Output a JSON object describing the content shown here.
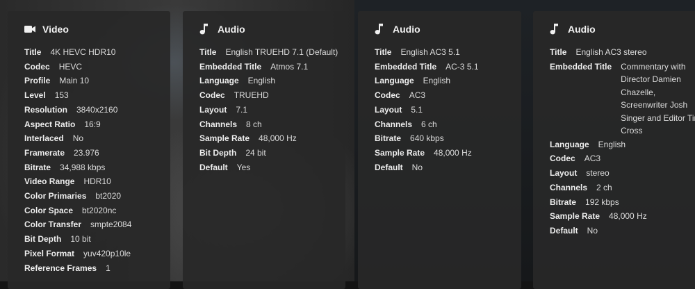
{
  "streams": [
    {
      "title": "Video",
      "icon": "video-camera-icon",
      "rows": [
        {
          "label": "Title",
          "value": "4K HEVC HDR10"
        },
        {
          "label": "Codec",
          "value": "HEVC"
        },
        {
          "label": "Profile",
          "value": "Main 10"
        },
        {
          "label": "Level",
          "value": "153"
        },
        {
          "label": "Resolution",
          "value": "3840x2160"
        },
        {
          "label": "Aspect Ratio",
          "value": "16:9"
        },
        {
          "label": "Interlaced",
          "value": "No"
        },
        {
          "label": "Framerate",
          "value": "23.976"
        },
        {
          "label": "Bitrate",
          "value": "34,988 kbps"
        },
        {
          "label": "Video Range",
          "value": "HDR10"
        },
        {
          "label": "Color Primaries",
          "value": "bt2020"
        },
        {
          "label": "Color Space",
          "value": "bt2020nc"
        },
        {
          "label": "Color Transfer",
          "value": "smpte2084"
        },
        {
          "label": "Bit Depth",
          "value": "10 bit"
        },
        {
          "label": "Pixel Format",
          "value": "yuv420p10le"
        },
        {
          "label": "Reference Frames",
          "value": "1"
        }
      ]
    },
    {
      "title": "Audio",
      "icon": "music-note-icon",
      "rows": [
        {
          "label": "Title",
          "value": "English TRUEHD 7.1 (Default)"
        },
        {
          "label": "Embedded Title",
          "value": "Atmos 7.1"
        },
        {
          "label": "Language",
          "value": "English"
        },
        {
          "label": "Codec",
          "value": "TRUEHD"
        },
        {
          "label": "Layout",
          "value": "7.1"
        },
        {
          "label": "Channels",
          "value": "8 ch"
        },
        {
          "label": "Sample Rate",
          "value": "48,000 Hz"
        },
        {
          "label": "Bit Depth",
          "value": "24 bit"
        },
        {
          "label": "Default",
          "value": "Yes"
        }
      ]
    },
    {
      "title": "Audio",
      "icon": "music-note-icon",
      "rows": [
        {
          "label": "Title",
          "value": "English AC3 5.1"
        },
        {
          "label": "Embedded Title",
          "value": "AC-3 5.1"
        },
        {
          "label": "Language",
          "value": "English"
        },
        {
          "label": "Codec",
          "value": "AC3"
        },
        {
          "label": "Layout",
          "value": "5.1"
        },
        {
          "label": "Channels",
          "value": "6 ch"
        },
        {
          "label": "Bitrate",
          "value": "640 kbps"
        },
        {
          "label": "Sample Rate",
          "value": "48,000 Hz"
        },
        {
          "label": "Default",
          "value": "No"
        }
      ]
    },
    {
      "title": "Audio",
      "icon": "music-note-icon",
      "rows": [
        {
          "label": "Title",
          "value": "English AC3 stereo"
        },
        {
          "label": "Embedded Title",
          "value": "Commentary with Director Damien Chazelle, Screenwriter Josh Singer and Editor Tim Cross",
          "wrap": true
        },
        {
          "label": "Language",
          "value": "English"
        },
        {
          "label": "Codec",
          "value": "AC3"
        },
        {
          "label": "Layout",
          "value": "stereo"
        },
        {
          "label": "Channels",
          "value": "2 ch"
        },
        {
          "label": "Bitrate",
          "value": "192 kbps"
        },
        {
          "label": "Sample Rate",
          "value": "48,000 Hz"
        },
        {
          "label": "Default",
          "value": "No"
        }
      ]
    }
  ]
}
